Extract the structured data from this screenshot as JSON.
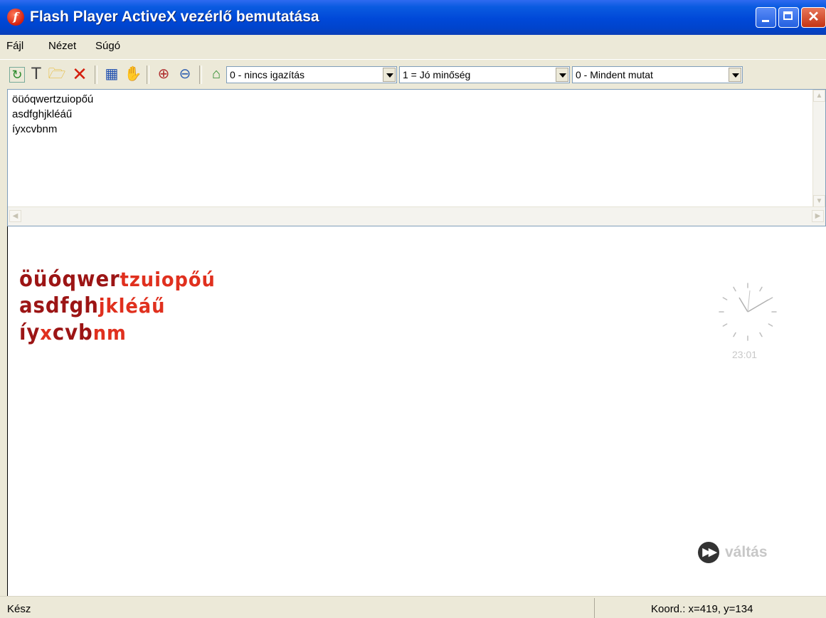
{
  "window": {
    "title": "Flash Player ActiveX vezérlő bemutatása"
  },
  "menu": {
    "items": [
      "Fájl",
      "Nézet",
      "Súgó"
    ]
  },
  "toolbar": {
    "icons": [
      "refresh-icon",
      "properties-icon",
      "open-folder-icon",
      "delete-icon",
      "grid-icon",
      "hand-icon",
      "zoom-in-icon",
      "zoom-out-icon",
      "home-icon"
    ],
    "combos": [
      {
        "name": "align",
        "value": "0 - nincs igazítás"
      },
      {
        "name": "quality",
        "value": "1 = Jó minőség"
      },
      {
        "name": "scale",
        "value": "0 - Mindent mutat"
      }
    ]
  },
  "textbox": {
    "lines": [
      "öüóqwertzuiopőú",
      "asdfghjkléáű",
      "íyxcvbnm"
    ]
  },
  "flash": {
    "lines": [
      "öüóqwertzuiopőú",
      "asdfghjkléáű",
      "íyxcvbnm"
    ],
    "clock_time": "23:01",
    "switch_label": "váltás"
  },
  "status": {
    "left": "Kész",
    "coords": "Koord.: x=419, y=134"
  },
  "colors": {
    "titlebar": "#0054e3",
    "flash_text_dark": "#9c1515",
    "flash_text_bright": "#e0301e"
  }
}
